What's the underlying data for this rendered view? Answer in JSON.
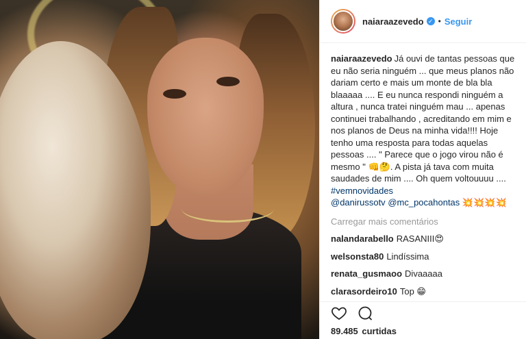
{
  "post": {
    "username": "naiaraazevedo",
    "verified_icon": "verified-badge-icon",
    "separator": "•",
    "follow_label": "Seguir"
  },
  "caption": {
    "user": "naiaraazevedo",
    "text": "Já ouvi de tantas pessoas que eu não seria ninguém ... que meus planos não dariam certo e mais um monte de bla bla blaaaaa .... E eu nunca respondi ninguém a altura , nunca tratei ninguém mau ... apenas continuei trabalhando , acreditando em mim e nos planos de Deus na minha vida!!!! Hoje tenho uma resposta para todas aquelas pessoas .... \" Parece que o jogo virou não é mesmo \" 👊🤔. A pista já tava com muita saudades de mim .... Oh quem voltouuuu .... ",
    "hashtag": "#vemnovidades",
    "mention1": "@danirussotv",
    "mention2": "@mc_pocahontas",
    "emojis": "💥💥💥💥"
  },
  "load_more_label": "Carregar mais comentários",
  "comments": [
    {
      "user": "nalandarabello",
      "text": "RASANIII😍"
    },
    {
      "user": "welsonsta80",
      "text": "Lindíssima"
    },
    {
      "user": "renata_gusmaoo",
      "text": "Divaaaaa"
    },
    {
      "user": "clarasordeiro10",
      "text": "Top 😁"
    }
  ],
  "likes": {
    "count": "89.485",
    "label": "curtidas"
  },
  "icons": {
    "like": "heart-icon",
    "comment": "comment-icon"
  }
}
